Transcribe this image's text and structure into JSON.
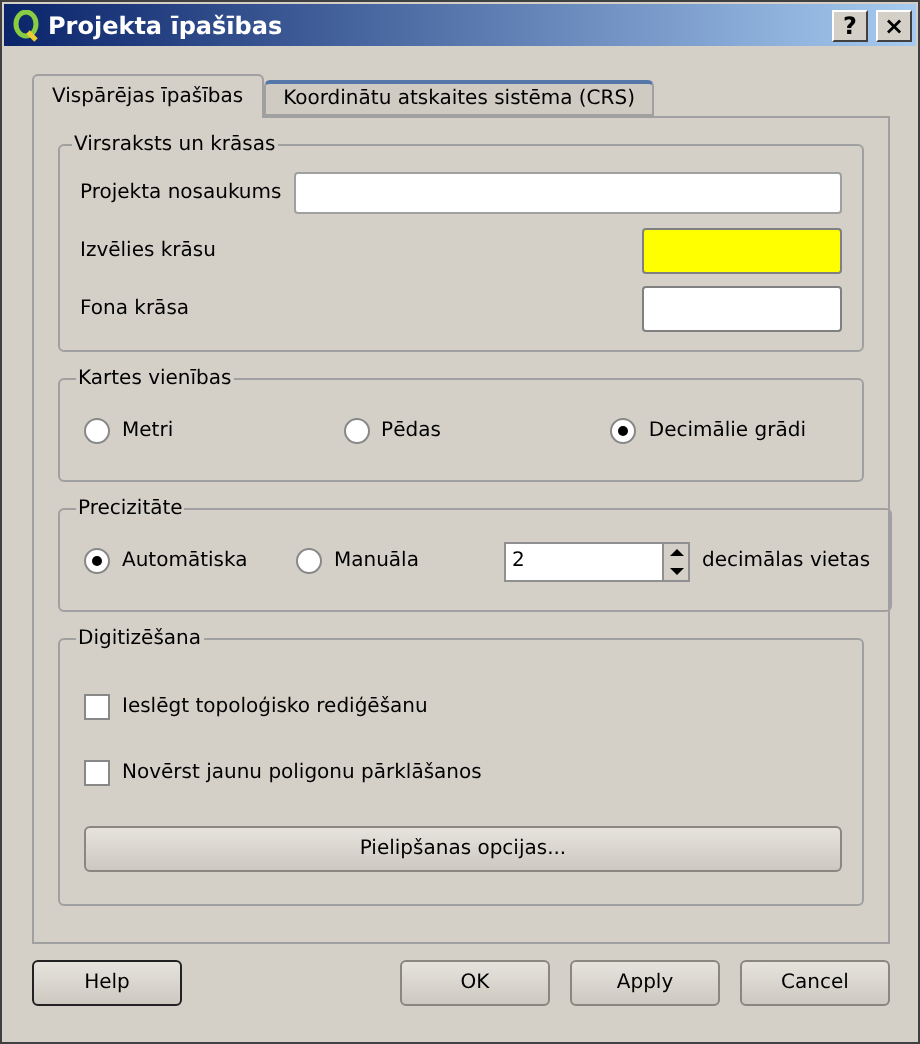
{
  "window": {
    "title": "Projekta īpašības",
    "title_buttons": [
      "?",
      "×"
    ]
  },
  "tabs": [
    {
      "label": "Vispārējas īpašības",
      "selected": true
    },
    {
      "label": "Koordinātu atskaites sistēma (CRS)",
      "selected": false
    }
  ],
  "title_group": {
    "legend": "Virsraksts un krāsas",
    "fields": [
      {
        "kind": "text",
        "label": "Projekta nosaukums"
      },
      {
        "kind": "color",
        "label": "Izvēlies krāsu",
        "color": "#ffff00"
      },
      {
        "kind": "color",
        "label": "Fona krāsa",
        "color": "#ffffff"
      }
    ]
  },
  "units_group": {
    "legend": "Kartes vienības",
    "options": [
      {
        "label": "Metri",
        "selected": false
      },
      {
        "label": "Pēdas",
        "selected": false
      },
      {
        "label": "Decimālie grādi",
        "selected": true
      }
    ]
  },
  "precision_group": {
    "legend": "Precizitāte",
    "options": [
      {
        "label": "Automātiska",
        "selected": true
      },
      {
        "label": "Manuāla",
        "selected": false
      }
    ],
    "spin_value": "2",
    "spin_suffix": "decimālas vietas"
  },
  "digitizing_group": {
    "legend": "Digitizēšana",
    "checkboxes": [
      {
        "label": "Ieslēgt topoloģisko rediģēšanu",
        "checked": false
      },
      {
        "label": "Novērst jaunu poligonu pārklāšanos",
        "checked": false
      }
    ],
    "button": "Pielipšanas opcijas..."
  },
  "buttons": {
    "left": [
      "Help"
    ],
    "right": [
      "OK",
      "Apply",
      "Cancel"
    ]
  }
}
